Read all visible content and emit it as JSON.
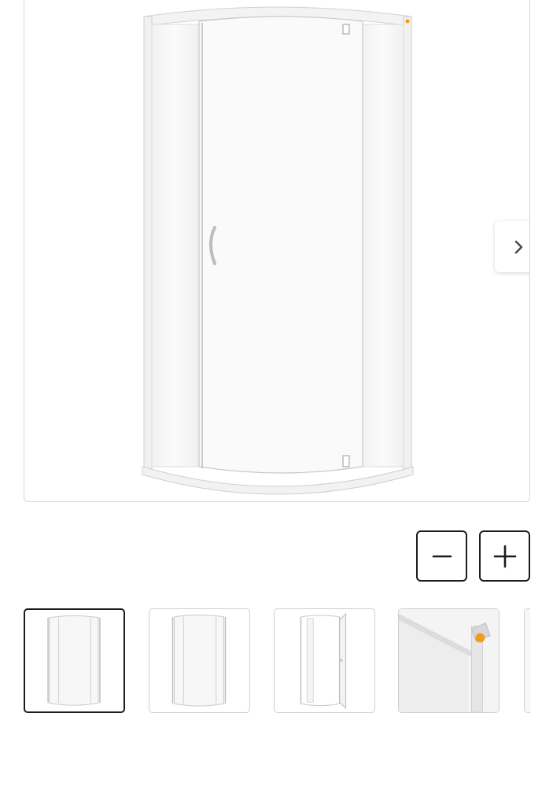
{
  "gallery": {
    "main_image": {
      "icon": "shower-enclosure-image"
    },
    "next_button": {
      "icon": "chevron-right-icon"
    },
    "zoom": {
      "zoom_out_icon": "minus-icon",
      "zoom_in_icon": "plus-icon"
    },
    "thumbnails": [
      {
        "icon": "shower-enclosure-front-thumbnail",
        "active": true
      },
      {
        "icon": "shower-enclosure-front-thumbnail-2",
        "active": false
      },
      {
        "icon": "shower-enclosure-open-door-thumbnail",
        "active": false
      },
      {
        "icon": "shower-hinge-detail-thumbnail",
        "active": false
      },
      {
        "icon": "partial-thumbnail",
        "active": false
      }
    ],
    "colors": {
      "border": "#d6d6d6",
      "active_border": "#1c1c1c",
      "accent_orange": "#f39a1e"
    }
  }
}
